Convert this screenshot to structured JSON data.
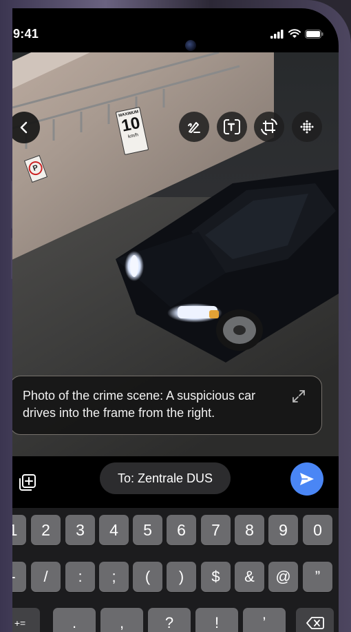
{
  "status_bar": {
    "time": "9:41"
  },
  "photo": {
    "sign_speed_top": "MAXIMUM",
    "sign_speed_value": "10",
    "sign_speed_unit": "km/h",
    "sign_parking": "P"
  },
  "toolbar": {
    "icons": [
      "back-icon",
      "markup-icon",
      "text-recognition-icon",
      "rotate-crop-icon",
      "more-dots-icon"
    ]
  },
  "caption": {
    "text": "Photo of the crime scene: A suspicious car drives into the frame from the right."
  },
  "composer": {
    "recipient": "To: Zentrale DUS"
  },
  "keyboard": {
    "row1": [
      "1",
      "2",
      "3",
      "4",
      "5",
      "6",
      "7",
      "8",
      "9",
      "0"
    ],
    "row2": [
      "-",
      "/",
      ":",
      ";",
      "(",
      ")",
      "$",
      "&",
      "@",
      "”"
    ],
    "row3_left": "+=",
    "row3_keys": [
      ".",
      ",",
      "?",
      "!",
      "’"
    ]
  },
  "colors": {
    "accent": "#4a86f5",
    "frame": "#5b5470"
  }
}
